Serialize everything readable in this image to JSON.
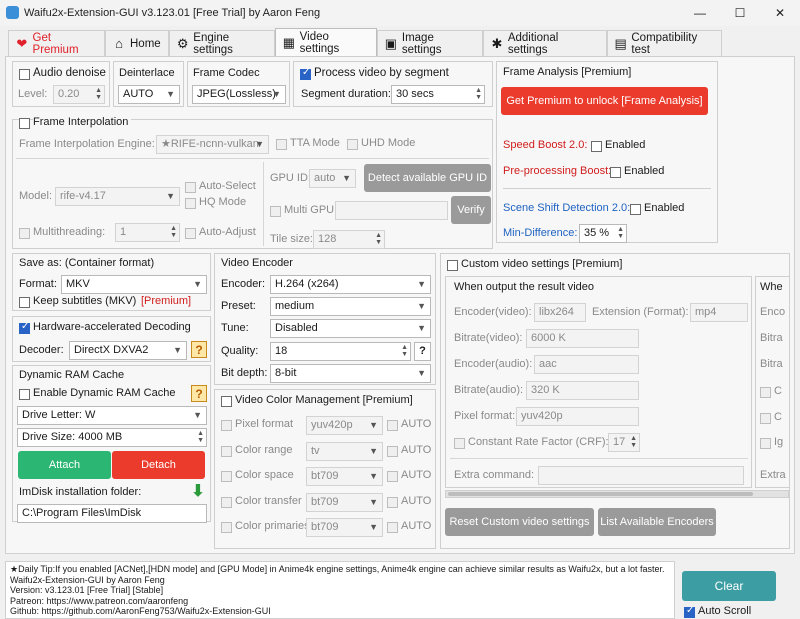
{
  "window": {
    "title": "Waifu2x-Extension-GUI v3.123.01 [Free Trial] by Aaron Feng",
    "minimize": "—",
    "maximize": "☐",
    "close": "✕"
  },
  "tabs": [
    {
      "label": "Get Premium",
      "icon": "heart-icon"
    },
    {
      "label": "Home",
      "icon": "home-icon"
    },
    {
      "label": "Engine settings",
      "icon": "gear-icon"
    },
    {
      "label": "Video settings",
      "icon": "film-icon"
    },
    {
      "label": "Image settings",
      "icon": "picture-icon"
    },
    {
      "label": "Additional settings",
      "icon": "settings-icon"
    },
    {
      "label": "Compatibility test",
      "icon": "clipboard-icon"
    }
  ],
  "audio_denoise": {
    "label": "Audio denoise",
    "level_label": "Level:",
    "level_value": "0.20"
  },
  "deinterlace": {
    "label": "Deinterlace",
    "value": "AUTO"
  },
  "frame_codec": {
    "label": "Frame Codec",
    "value": "JPEG(Lossless)"
  },
  "segment": {
    "label": "Process video by segment",
    "duration_label": "Segment duration:",
    "duration_value": "30 secs"
  },
  "frame_analysis": {
    "title": "Frame Analysis [Premium]",
    "button": "Get Premium to unlock [Frame Analysis]",
    "speed_boost": "Speed Boost 2.0:",
    "preprocessing_boost": "Pre-processing Boost:",
    "enabled": "Enabled",
    "scene_shift": "Scene Shift Detection 2.0:",
    "min_diff_label": "Min-Difference:",
    "min_diff_value": "35 %"
  },
  "frame_interp": {
    "title": "Frame Interpolation",
    "engine_label": "Frame Interpolation Engine:",
    "engine_value": "★RIFE-ncnn-vulkan",
    "tta": "TTA Mode",
    "uhd": "UHD Mode",
    "model_label": "Model:",
    "model_value": "rife-v4.17",
    "auto_select": "Auto-Select",
    "hq_mode": "HQ Mode",
    "multithreading_label": "Multithreading:",
    "multithreading_value": "1",
    "auto_adjust": "Auto-Adjust",
    "gpu_id_label": "GPU ID:",
    "gpu_id_value": "auto",
    "detect_button": "Detect available GPU ID",
    "multi_gpu": "Multi GPU",
    "verify_button": "Verify",
    "tile_label": "Tile size:",
    "tile_value": "128"
  },
  "save_as": {
    "title": "Save as: (Container format)",
    "format_label": "Format:",
    "format_value": "MKV",
    "keep_subtitles": "Keep subtitles (MKV)",
    "premium_tag": "[Premium]"
  },
  "hw_decoding": {
    "label": "Hardware-accelerated Decoding",
    "decoder_label": "Decoder:",
    "decoder_value": "DirectX DXVA2"
  },
  "ram_cache": {
    "title": "Dynamic RAM Cache",
    "enable_label": "Enable Dynamic RAM Cache",
    "drive_letter": "Drive Letter: W",
    "drive_size": "Drive Size: 4000 MB",
    "attach": "Attach",
    "detach": "Detach",
    "folder_label": "ImDisk installation folder:",
    "folder_value": "C:\\Program Files\\ImDisk"
  },
  "video_encoder": {
    "title": "Video Encoder",
    "encoder_label": "Encoder:",
    "encoder_value": "H.264 (x264)",
    "preset_label": "Preset:",
    "preset_value": "medium",
    "tune_label": "Tune:",
    "tune_value": "Disabled",
    "quality_label": "Quality:",
    "quality_value": "18",
    "bitdepth_label": "Bit depth:",
    "bitdepth_value": "8-bit"
  },
  "color_mgmt": {
    "title": "Video Color Management [Premium]",
    "rows": [
      {
        "label": "Pixel format",
        "value": "yuv420p"
      },
      {
        "label": "Color range",
        "value": "tv"
      },
      {
        "label": "Color space",
        "value": "bt709"
      },
      {
        "label": "Color transfer",
        "value": "bt709"
      },
      {
        "label": "Color primaries",
        "value": "bt709"
      }
    ],
    "auto": "AUTO"
  },
  "custom_video": {
    "title": "Custom video settings [Premium]",
    "section_title": "When output the result video",
    "section_title_2": "Whe",
    "encoder_video_label": "Encoder(video):",
    "encoder_video_value": "libx264",
    "extension_label": "Extension (Format):",
    "extension_value": "mp4",
    "bitrate_video_label": "Bitrate(video):",
    "bitrate_video_value": "6000 K",
    "encoder_audio_label": "Encoder(audio):",
    "encoder_audio_value": "aac",
    "bitrate_audio_label": "Bitrate(audio):",
    "bitrate_audio_value": "320 K",
    "pixel_format_label": "Pixel format:",
    "pixel_format_value": "yuv420p",
    "crf_label": "Constant Rate Factor (CRF):",
    "crf_value": "17",
    "extra_label": "Extra command:",
    "right_cut": [
      "Enco",
      "Bitra",
      "Bitra",
      "C",
      "C",
      "Ig",
      "Extra"
    ],
    "reset_button": "Reset Custom video settings",
    "list_button": "List Available Encoders"
  },
  "log": {
    "lines": [
      "★Daily Tip:If you enabled [ACNet],[HDN mode] and [GPU Mode] in Anime4k engine settings, Anime4k engine can achieve similar results as Waifu2x, but a lot faster.",
      "Waifu2x-Extension-GUI by Aaron Feng",
      "Version: v3.123.01 [Free Trial] [Stable]",
      "Patreon: https://www.patreon.com/aaronfeng",
      "Github: https://github.com/AaronFeng753/Waifu2x-Extension-GUI"
    ]
  },
  "clear_button": "Clear",
  "auto_scroll": "Auto Scroll",
  "colors": {
    "red": "#ea3b2c",
    "green": "#2bb673",
    "gray_button": "#9a9a9a",
    "accent_blue": "#2a63c6",
    "clear_teal": "#3c9ea3"
  }
}
